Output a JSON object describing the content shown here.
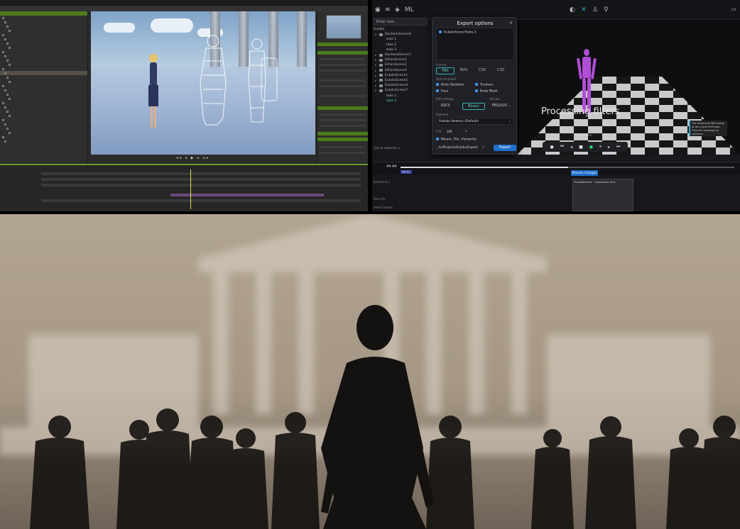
{
  "panelA": {
    "name": "3d-character-animation-editor",
    "timeline_speed": "Speed",
    "timeline_frame": "Frame",
    "status": "Realtime Display"
  },
  "panelB": {
    "search_placeholder": "Enter text...",
    "tree_root": "Eulalia",
    "tree": [
      {
        "label": "DeclaresScene6",
        "caret": "▾",
        "folder": true
      },
      {
        "label": "take 1",
        "caret": "",
        "folder": false
      },
      {
        "label": "take 2",
        "caret": "",
        "folder": false
      },
      {
        "label": "take 3",
        "caret": "",
        "folder": false
      },
      {
        "label": "DeclaresScene7",
        "caret": "▸",
        "folder": true
      },
      {
        "label": "EthicsScene1",
        "caret": "▸",
        "folder": true
      },
      {
        "label": "EthicsScene2",
        "caret": "▸",
        "folder": true
      },
      {
        "label": "EthicsScene3",
        "caret": "▸",
        "folder": true
      },
      {
        "label": "EulaliaScene1",
        "caret": "▸",
        "folder": true
      },
      {
        "label": "EulaliaScene2",
        "caret": "▸",
        "folder": true
      },
      {
        "label": "EulaliaScene3",
        "caret": "▸",
        "folder": true
      },
      {
        "label": "EulaliaScene7",
        "caret": "▾",
        "folder": true
      },
      {
        "label": "take 1",
        "caret": "",
        "folder": false
      },
      {
        "label": "take 2",
        "caret": "",
        "folder": false,
        "sel": true
      }
    ],
    "goto_label": "Go to exports",
    "modal_title": "Export options",
    "take_item": "EulaliaScene7take-1",
    "format_label": "Format",
    "formats": [
      "FBX",
      "BVH",
      "CSV",
      "C3D"
    ],
    "data_included_label": "Data included",
    "checks": [
      "Body Skeleton",
      "Trackers",
      "Face",
      "Body Mesh"
    ],
    "fbx_settings_label": "FBX settings",
    "version_label": "Version",
    "encodings": [
      "ASCII",
      "Binary"
    ],
    "version_value": "FBX2020 ⌄",
    "skeleton_label": "Skeleton",
    "skeleton_value": "Rokoko Newton (Default)",
    "fps_label": "FPS",
    "fps_value": "100",
    "mixamo_label": "Mixam. File. Hierarchy",
    "path_value": "...ts/Projects/Eulalia/Export",
    "export_label": "Export",
    "processing_text": "Processing filters",
    "timecode": "01:00 s",
    "tip_text": "The Smartsuit SDK needs to do a sync first take. Click the message to continue.",
    "ruler_value": "44.44",
    "ruler_marker": "00:01",
    "process_changes": "Process changes",
    "window_title": "EulaliaScene7 - Explorador de a...",
    "bottom_rows": [
      "Smartsuit 1",
      "Face Pro",
      "Smart Gloves"
    ]
  },
  "colors": {
    "accent_green": "#6a9a2a",
    "figure_purple": "#b04fd6",
    "export_blue": "#1f6fcc",
    "teal": "#38b2ac"
  },
  "photo": {
    "name": "stage-performance-photo"
  }
}
